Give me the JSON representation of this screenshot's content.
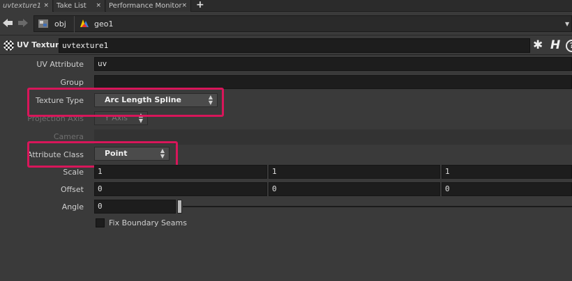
{
  "tabs": [
    {
      "label": "uvtexture1",
      "close": "×"
    },
    {
      "label": "Take List",
      "close": "×"
    },
    {
      "label": "Performance Monitor",
      "close": "×"
    }
  ],
  "tab_add": "+",
  "path": {
    "back_icon": "arrow-left-icon",
    "forward_icon": "arrow-right-icon",
    "crumbs": [
      {
        "label": "obj",
        "icon": "obj-network-icon"
      },
      {
        "label": "geo1",
        "icon": "geometry-node-icon"
      }
    ]
  },
  "node": {
    "type_label": "UV Texture",
    "name": "uvtexture1",
    "icons": [
      "uv-texture-icon",
      "gear-icon",
      "houdini-h-icon",
      "help-icon"
    ]
  },
  "params": {
    "uv_attribute": {
      "label": "UV Attribute",
      "value": "uv"
    },
    "group": {
      "label": "Group",
      "value": ""
    },
    "texture_type": {
      "label": "Texture Type",
      "value": "Arc Length Spline"
    },
    "projection_axis": {
      "label": "Projection Axis",
      "value": "Y Axis"
    },
    "camera": {
      "label": "Camera",
      "value": ""
    },
    "attribute_class": {
      "label": "Attribute Class",
      "value": "Point"
    },
    "scale": {
      "label": "Scale",
      "values": [
        "1",
        "1",
        "1"
      ]
    },
    "offset": {
      "label": "Offset",
      "values": [
        "0",
        "0",
        "0"
      ]
    },
    "angle": {
      "label": "Angle",
      "value": "0",
      "slider_fraction": 0
    },
    "fix_boundary_seams": {
      "label": "Fix Boundary Seams",
      "checked": false
    }
  },
  "colors": {
    "highlight": "#d8165a",
    "background": "#3a3a3a",
    "field": "#1d1d1d"
  }
}
